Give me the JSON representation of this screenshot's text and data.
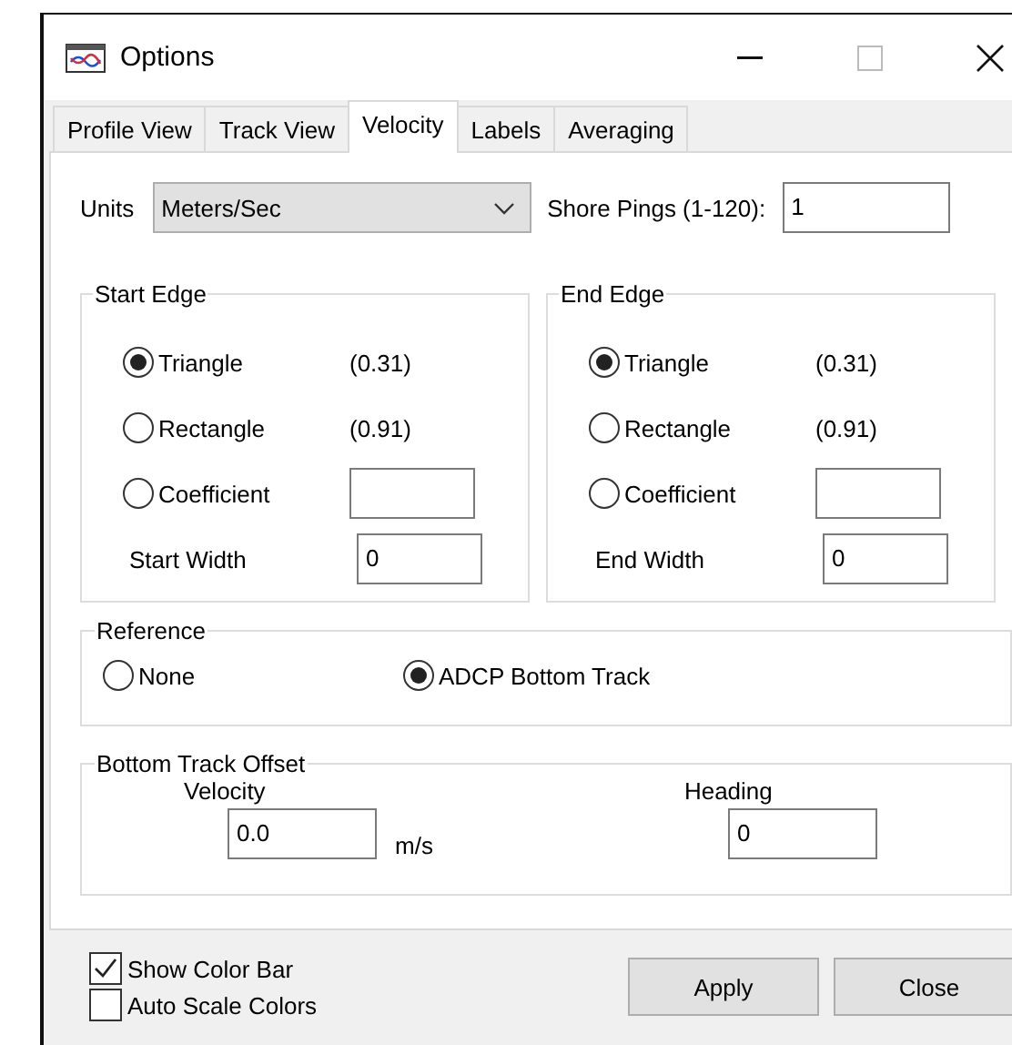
{
  "window": {
    "title": "Options"
  },
  "tabs": [
    {
      "label": "Profile View",
      "selected": false
    },
    {
      "label": "Track View",
      "selected": false
    },
    {
      "label": "Velocity",
      "selected": true
    },
    {
      "label": "Labels",
      "selected": false
    },
    {
      "label": "Averaging",
      "selected": false
    }
  ],
  "units": {
    "label": "Units",
    "value": "Meters/Sec"
  },
  "shore_pings": {
    "label": "Shore Pings (1-120):",
    "value": "1"
  },
  "edges": [
    {
      "title": "Start Edge",
      "options": [
        {
          "kind": "value",
          "label": "Triangle",
          "value": "(0.31)",
          "selected": true
        },
        {
          "kind": "value",
          "label": "Rectangle",
          "value": "(0.91)",
          "selected": false
        },
        {
          "kind": "field",
          "label": "Coefficient",
          "selected": false
        }
      ],
      "width_label": "Start Width",
      "width_value": "0"
    },
    {
      "title": "End Edge",
      "options": [
        {
          "kind": "value",
          "label": "Triangle",
          "value": "(0.31)",
          "selected": true
        },
        {
          "kind": "value",
          "label": "Rectangle",
          "value": "(0.91)",
          "selected": false
        },
        {
          "kind": "field",
          "label": "Coefficient",
          "selected": false
        }
      ],
      "width_label": "End Width",
      "width_value": "0"
    }
  ],
  "reference": {
    "title": "Reference",
    "options": [
      {
        "label": "None",
        "selected": false
      },
      {
        "label": "ADCP Bottom Track",
        "selected": true
      }
    ]
  },
  "offset": {
    "title": "Bottom Track Offset",
    "velocity": {
      "label": "Velocity",
      "value": "0.0",
      "unit": "m/s"
    },
    "heading": {
      "label": "Heading",
      "value": "0"
    }
  },
  "checkboxes": [
    {
      "label": "Show Color Bar",
      "checked": true
    },
    {
      "label": "Auto Scale Colors",
      "checked": false
    }
  ],
  "buttons": [
    "Apply",
    "Close"
  ]
}
